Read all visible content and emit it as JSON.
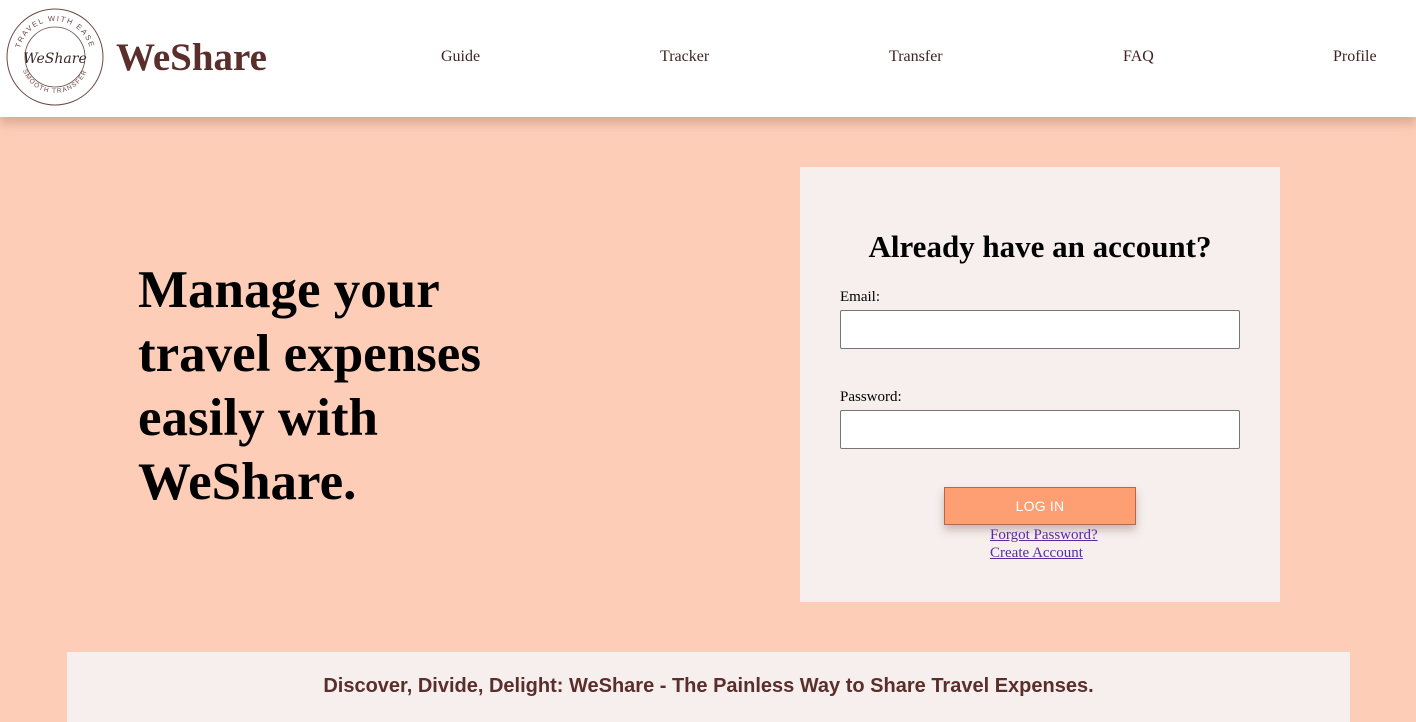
{
  "brand": {
    "name": "WeShare",
    "logo_script": "WeShare",
    "logo_ring_top": "TRAVEL WITH EASE",
    "logo_ring_bottom": "SMOOTH TRANSFER"
  },
  "nav": {
    "items": [
      {
        "label": "Guide"
      },
      {
        "label": "Tracker"
      },
      {
        "label": "Transfer"
      },
      {
        "label": "FAQ"
      },
      {
        "label": "Profile"
      }
    ]
  },
  "hero": {
    "heading": "Manage your travel expenses easily with WeShare."
  },
  "login": {
    "title": "Already have an account?",
    "email_label": "Email:",
    "email_value": "",
    "password_label": "Password:",
    "password_value": "",
    "button_label": "LOG IN",
    "forgot_link": "Forgot Password?",
    "create_link": "Create Account"
  },
  "tagline": "Discover, Divide, Delight: WeShare - The Painless Way to Share Travel Expenses.",
  "colors": {
    "page_background": "#fdcdb8",
    "card_background": "#f6efee",
    "accent_button": "#fd9f73",
    "brand_text": "#5a2e2a"
  }
}
